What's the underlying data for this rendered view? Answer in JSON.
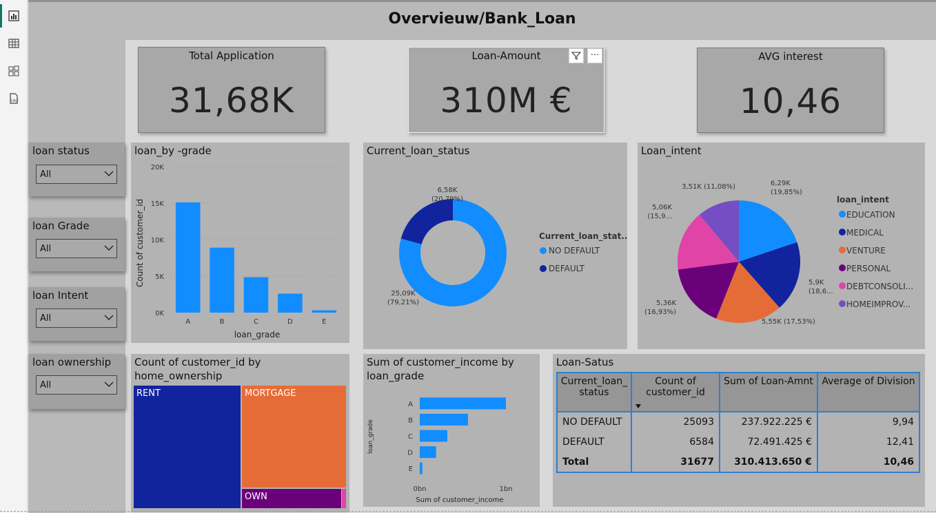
{
  "report": {
    "title": "Overvieuw/Bank_Loan"
  },
  "rail": {
    "icons": [
      "report-view-icon",
      "table-view-icon",
      "model-view-icon",
      "dax-query-icon"
    ]
  },
  "kpis": {
    "total_application": {
      "label": "Total Application",
      "value": "31,68K"
    },
    "loan_amount": {
      "label": "Loan-Amount",
      "value": "310M €"
    },
    "avg_interest": {
      "label": "AVG interest",
      "value": "10,46"
    }
  },
  "visual_header": {
    "more_label": "···"
  },
  "slicers": [
    {
      "title": "loan status",
      "value": "All"
    },
    {
      "title": "loan Grade",
      "value": "All"
    },
    {
      "title": "loan Intent",
      "value": "All"
    },
    {
      "title": "loan ownership",
      "value": "All"
    }
  ],
  "chart_data": [
    {
      "type": "bar",
      "title": "loan_by -grade",
      "xlabel": "loan_grade",
      "ylabel": "Count of customer_id",
      "categories": [
        "A",
        "B",
        "C",
        "D",
        "E"
      ],
      "values": [
        15100,
        8900,
        4850,
        2600,
        320
      ],
      "ylim": [
        0,
        20000
      ],
      "yticks": [
        "0K",
        "5K",
        "10K",
        "15K",
        "20K"
      ],
      "grid": true,
      "color": "#118dff"
    },
    {
      "type": "pie",
      "title": "Current_loan_status",
      "donut": true,
      "legend_title": "Current_loan_stat...",
      "slices": [
        {
          "name": "NO DEFAULT",
          "value": 25090,
          "label": "25,09K",
          "pct": "(79,21%)",
          "color": "#118dff"
        },
        {
          "name": "DEFAULT",
          "value": 6580,
          "label": "6,58K",
          "pct": "(20,79%)",
          "color": "#12239e"
        }
      ]
    },
    {
      "type": "pie",
      "title": "Loan_intent",
      "legend_title": "loan_intent",
      "slices": [
        {
          "name": "EDUCATION",
          "value": 6290,
          "label": "6,29K",
          "pct": "(19,85%)",
          "color": "#118dff"
        },
        {
          "name": "MEDICAL",
          "value": 5900,
          "label": "5,9K",
          "pct": "(18,6...",
          "color": "#12239e"
        },
        {
          "name": "VENTURE",
          "value": 5550,
          "label": "5,55K (17,53%)",
          "pct": "",
          "color": "#e66c37"
        },
        {
          "name": "PERSONAL",
          "value": 5360,
          "label": "5,36K",
          "pct": "(16,93%)",
          "color": "#6b007b"
        },
        {
          "name": "DEBTCONSOLI...",
          "value": 5060,
          "label": "5,06K",
          "pct": "(15,9...",
          "color": "#e044a7"
        },
        {
          "name": "HOMEIMPROV...",
          "value": 3510,
          "label": "3,51K (11,08%)",
          "pct": "",
          "color": "#744ec2"
        }
      ]
    },
    {
      "type": "treemap",
      "title": "Count of customer_id by home_ownership",
      "title_lines": [
        "Count of customer_id by",
        "home_ownership"
      ],
      "items": [
        {
          "name": "RENT",
          "color": "#12239e"
        },
        {
          "name": "MORTGAGE",
          "color": "#e66c37"
        },
        {
          "name": "OWN",
          "color": "#6b007b"
        },
        {
          "name": "",
          "color": "#e044a7"
        }
      ]
    },
    {
      "type": "bar",
      "orientation": "horizontal",
      "title": "Sum of customer_income by loan_grade",
      "title_lines": [
        "Sum of customer_income by",
        "loan_grade"
      ],
      "xlabel": "Sum of customer_income",
      "ylabel": "loan_grade",
      "categories": [
        "A",
        "B",
        "C",
        "D",
        "E"
      ],
      "values": [
        1.0,
        0.56,
        0.32,
        0.19,
        0.03
      ],
      "xlim": [
        0,
        1.2
      ],
      "xticks": [
        "0bn",
        "1bn"
      ],
      "color": "#118dff"
    }
  ],
  "table": {
    "title": "Loan-Satus",
    "headers": [
      [
        "Current_loan_",
        "status"
      ],
      [
        "Count of",
        "customer_id"
      ],
      [
        "Sum of Loan-Amnt"
      ],
      [
        "Average of Division"
      ]
    ],
    "rows": [
      [
        "NO DEFAULT",
        "25093",
        "237.922.225 €",
        "9,94"
      ],
      [
        "DEFAULT",
        "6584",
        "72.491.425 €",
        "12,41"
      ]
    ],
    "total": [
      "Total",
      "31677",
      "310.413.650 €",
      "10,46"
    ]
  }
}
